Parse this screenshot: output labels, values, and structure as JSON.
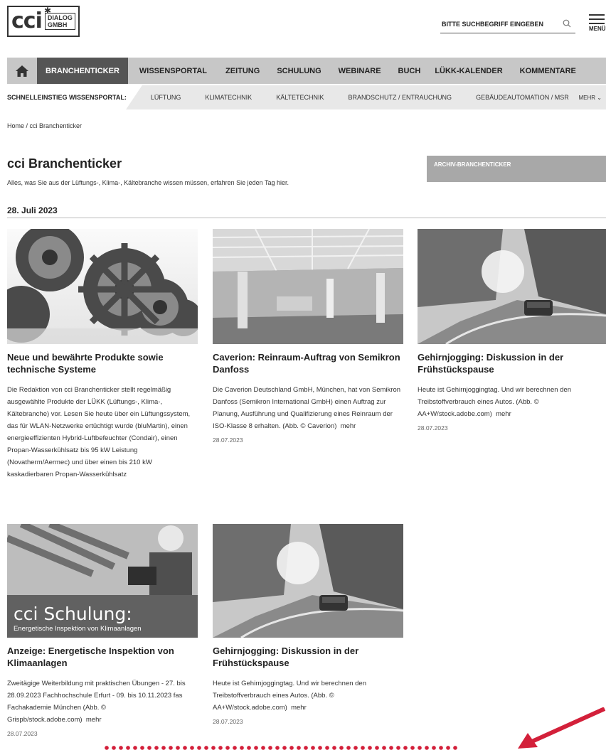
{
  "header": {
    "logo_main": "cci",
    "logo_sub_1": "DIALOG",
    "logo_sub_2": "GMBH",
    "search_placeholder": "BITTE SUCHBEGRIFF EINGEBEN",
    "search_icon": "search-icon",
    "menu_label": "MENÜ"
  },
  "nav": {
    "home_icon": "home-icon",
    "items": [
      "BRANCHENTICKER",
      "WISSENSPORTAL",
      "ZEITUNG",
      "SCHULUNG",
      "WEBINARE",
      "BUCH",
      "LÜKK-KALENDER",
      "KOMMENTARE"
    ]
  },
  "subnav": {
    "lead": "SCHNELLEINSTIEG WISSENSPORTAL:",
    "items": [
      "LÜFTUNG",
      "KLIMATECHNIK",
      "KÄLTETECHNIK",
      "BRANDSCHUTZ / ENTRAUCHUNG",
      "GEBÄUDEAUTOMATION / MSR"
    ],
    "more": "MEHR"
  },
  "breadcrumb": "Home / cci Branchenticker",
  "page": {
    "title": "cci Branchenticker",
    "intro": "Alles, was Sie aus der Lüftungs-, Klima-, Kältebranche wissen müssen, erfahren Sie jeden Tag hier.",
    "archive_button": "ARCHIV-BRANCHENTICKER",
    "date_heading": "28. Juli 2023"
  },
  "articles": [
    {
      "title": "Neue und bewährte Produkte sowie technische Systeme",
      "text": "Die Redaktion von cci Branchenticker stellt regelmäßig ausgewählte Produkte der LÜKK (Lüftungs-, Klima-, Kältebranche) vor. Lesen Sie heute über ein Lüftungssystem, das für WLAN-Netzwerke ertüchtigt wurde (bluMartin), einen energieeffizienten Hybrid-Luftbefeuchter (Condair), einen Propan-Wasserkühlsatz bis 95 kW Leistung (Novatherm/Aermec) und über einen bis 210 kW kaskadierbaren Propan-Wasserkühlsatz",
      "more": "",
      "date": ""
    },
    {
      "title": "Caverion: Reinraum-Auftrag von Semikron Danfoss",
      "text": "Die Caverion Deutschland GmbH, München, hat von Semikron Danfoss (Semikron International GmbH) einen Auftrag zur Planung, Ausführung und Qualifizierung eines Reinraum der ISO-Klasse 8 erhalten. (Abb. © Caverion)",
      "more": "mehr",
      "date": "28.07.2023"
    },
    {
      "title": "Gehirnjogging: Diskussion in der Frühstückspause",
      "text": "Heute ist Gehirnjoggingtag. Und wir berechnen den Treibstoffverbrauch eines Autos. (Abb. © AA+W/stock.adobe.com)",
      "more": "mehr",
      "date": "28.07.2023"
    },
    {
      "title": "Anzeige: Energetische Inspektion von Klimaanlagen",
      "text": "Zweitägige Weiterbildung mit praktischen Übungen - 27. bis 28.09.2023 Fachhochschule Erfurt - 09. bis 10.11.2023 fas Fachakademie München (Abb. © Grispb/stock.adobe.com)",
      "more": "mehr",
      "date": "28.07.2023",
      "image_title": "cci Schulung:",
      "image_subtitle": "Energetische Inspektion von Klimaanlagen"
    },
    {
      "title": "Gehirnjogging: Diskussion in der Frühstückspause",
      "text": "Heute ist Gehirnjoggingtag. Und wir berechnen den Treibstoffverbrauch eines Autos. (Abb. © AA+W/stock.adobe.com)",
      "more": "mehr",
      "date": "28.07.2023"
    }
  ],
  "colors": {
    "nav_bg": "#c7c7c7",
    "nav_active": "#555555",
    "subnav_bg": "#e8e8e8",
    "archive_bg": "#a8a8a8",
    "annotation_red": "#d3203a"
  }
}
